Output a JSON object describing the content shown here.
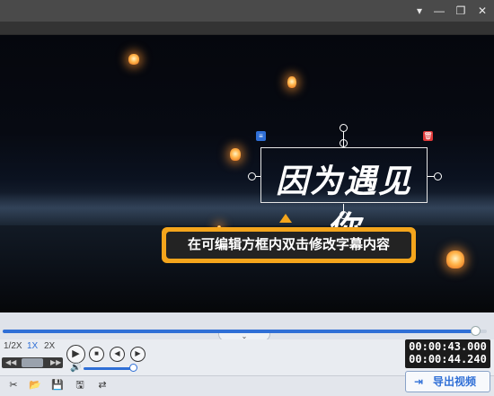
{
  "window": {
    "menu_glyph": "▾",
    "minimize_glyph": "—",
    "restore_glyph": "❐",
    "close_glyph": "✕"
  },
  "video": {
    "subtitle_text": "因为遇见你",
    "hint_text": "在可编辑方框内双击修改字幕内容",
    "settings_badge": "≡",
    "delete_badge": "🗑"
  },
  "playback": {
    "progress_fraction": 0.975,
    "collapse_glyph": "⌄",
    "speed_options": [
      "1/2X",
      "1X",
      "2X"
    ],
    "active_speed": "1X",
    "rewind_glyph": "◀◀",
    "forward_glyph": "▶▶",
    "play_glyph": "▶",
    "stop_glyph": "■",
    "prev_glyph": "◀",
    "next_glyph": "▶",
    "volume_glyph": "🔊",
    "volume_fraction": 1.0
  },
  "time": {
    "current": "00:00:43.000",
    "total": "00:00:44.240"
  },
  "bottom": {
    "icons": [
      "✂",
      "📂",
      "💾",
      "🖫",
      "⇄"
    ],
    "export_label": "导出视频",
    "export_glyph": "⇥"
  },
  "colors": {
    "accent": "#2f6fd6",
    "hint_border": "#f4a51c",
    "delete_red": "#e03a3a"
  }
}
